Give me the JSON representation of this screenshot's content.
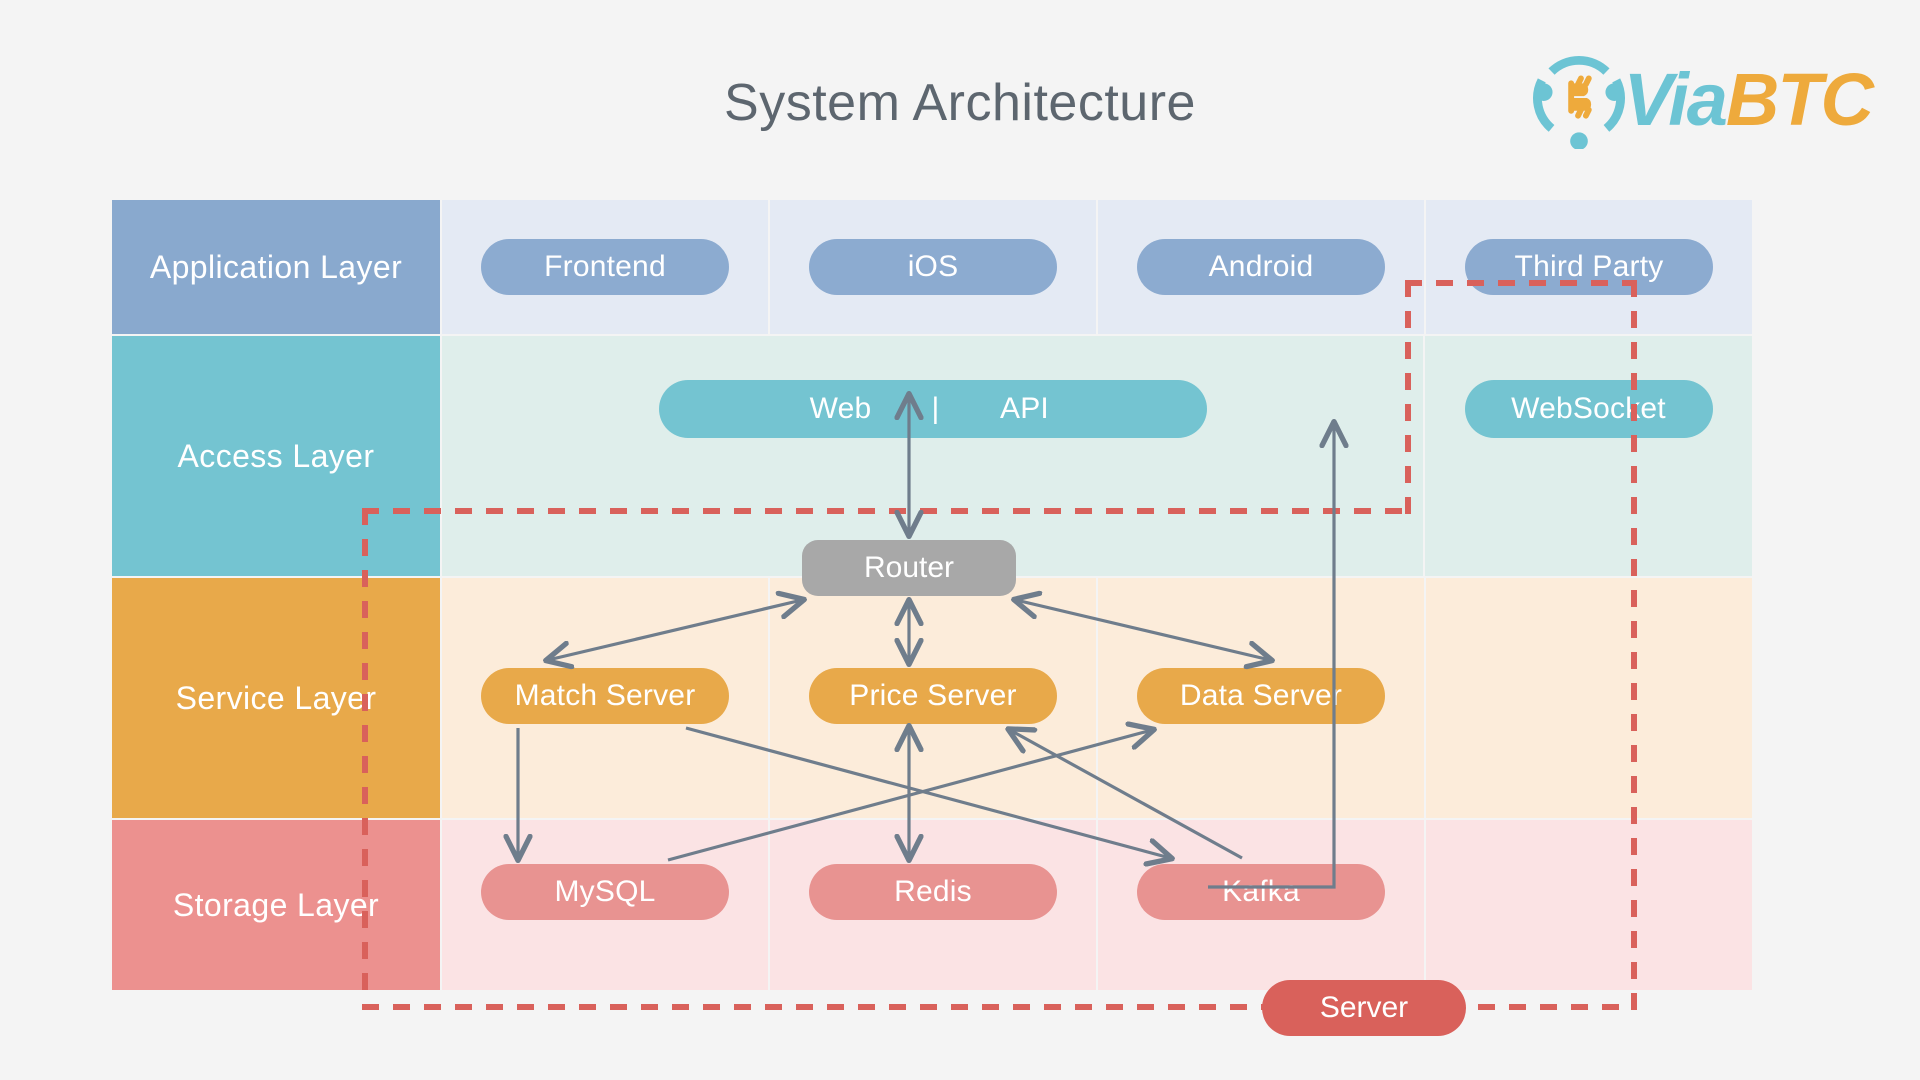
{
  "header": {
    "title": "System Architecture",
    "brand": {
      "mark_icon": "viabtc-bitcoin-circle-icon",
      "name_part1": "Via",
      "name_part2": "BTC",
      "color_teal": "#6cc4d4",
      "color_orange": "#eeaa3c"
    }
  },
  "diagram": {
    "type": "layered-architecture",
    "layers": [
      {
        "label": "Application Layer",
        "label_color": "#89a9ce",
        "cell_color": "#e4eaf4",
        "node_color": "#8cabd0",
        "nodes": [
          "Frontend",
          "iOS",
          "Android",
          "Third Party"
        ]
      },
      {
        "label": "Access Layer",
        "label_color": "#74c4d1",
        "cell_color": "#dfeeeb",
        "node_color": "#74c4d1",
        "nodes": [
          "Web",
          "API",
          "WebSocket"
        ],
        "divider": "|"
      },
      {
        "label": "Service Layer",
        "label_color": "#e8a94a",
        "cell_color": "#fcecda",
        "node_color": "#e8a94a",
        "nodes": [
          "Match Server",
          "Price Server",
          "Data Server"
        ]
      },
      {
        "label": "Storage Layer",
        "label_color": "#ec918f",
        "cell_color": "#fbe3e4",
        "node_color": "#e89391",
        "nodes": [
          "MySQL",
          "Redis",
          "Kafka"
        ]
      }
    ],
    "router": {
      "label": "Router",
      "color": "#a8a8a8"
    },
    "boundary": {
      "legend_label": "Server",
      "legend_color": "#d9615b",
      "stroke_color": "#d9615b",
      "style": "dashed"
    },
    "arrow_color": "#6f7d8c",
    "connections": [
      {
        "from": "Web | API",
        "to": "Router",
        "direction": "both"
      },
      {
        "from": "Router",
        "to": "Match Server",
        "direction": "both"
      },
      {
        "from": "Router",
        "to": "Price Server",
        "direction": "both"
      },
      {
        "from": "Router",
        "to": "Data Server",
        "direction": "both"
      },
      {
        "from": "Match Server",
        "to": "MySQL",
        "direction": "to"
      },
      {
        "from": "Match Server",
        "to": "Kafka",
        "direction": "to"
      },
      {
        "from": "Price Server",
        "to": "Redis",
        "direction": "both"
      },
      {
        "from": "MySQL",
        "to": "Data Server",
        "direction": "to"
      },
      {
        "from": "Kafka",
        "to": "Price Server",
        "direction": "to"
      },
      {
        "from": "Kafka",
        "to": "WebSocket",
        "direction": "to"
      }
    ]
  }
}
